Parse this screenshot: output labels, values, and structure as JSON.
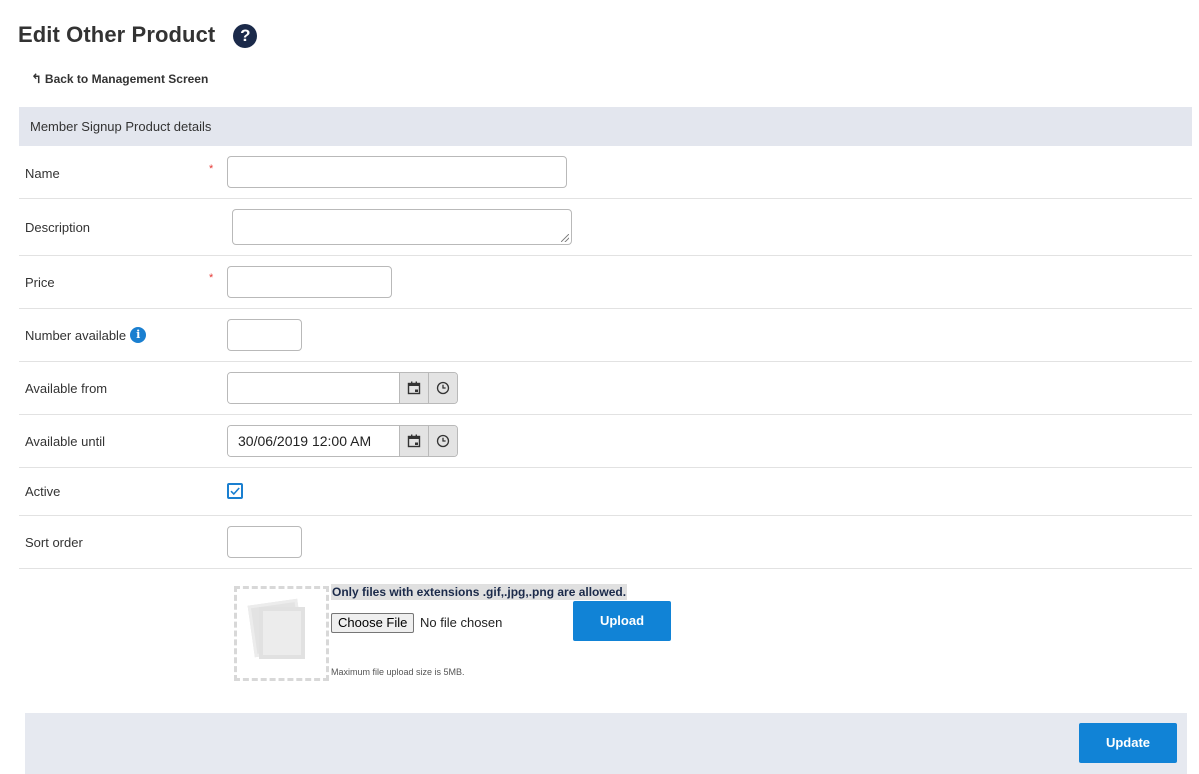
{
  "page": {
    "title": "Edit Other Product",
    "help_icon": "question-circle-icon",
    "back_link": "Back to Management Screen"
  },
  "section": {
    "title": "Member Signup Product details"
  },
  "form": {
    "name": {
      "label": "Name",
      "required_mark": "*",
      "value": ""
    },
    "description": {
      "label": "Description",
      "value": ""
    },
    "price": {
      "label": "Price",
      "required_mark": "*",
      "value": ""
    },
    "number_available": {
      "label": "Number available",
      "info_icon": "i",
      "value": ""
    },
    "available_from": {
      "label": "Available from",
      "value": ""
    },
    "available_until": {
      "label": "Available until",
      "value": "30/06/2019 12:00 AM"
    },
    "active": {
      "label": "Active",
      "checked": true
    },
    "sort_order": {
      "label": "Sort order",
      "value": ""
    }
  },
  "upload": {
    "note": "Only files with extensions .gif,.jpg,.png are allowed.",
    "choose_file_label": "Choose File",
    "no_file_text": "No file chosen",
    "upload_button": "Upload",
    "max_size_text": "Maximum file upload size is 5MB."
  },
  "footer": {
    "update_button": "Update"
  },
  "colors": {
    "accent": "#1183d6",
    "section_bg": "#e3e6ee",
    "required": "#e53935"
  }
}
